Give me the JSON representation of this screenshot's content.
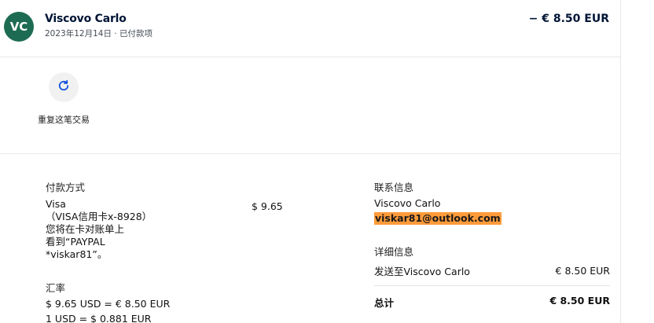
{
  "header": {
    "avatar_initials": "VC",
    "merchant_name": "Viscovo Carlo",
    "subtitle": "2023年12月14日 · 已付款项",
    "amount": "− € 8.50 EUR"
  },
  "actions": {
    "repeat_label": "重复这笔交易",
    "repeat_icon": "refresh-icon"
  },
  "funding": {
    "title": "付款方式",
    "lines": [
      "Visa",
      "（VISA信用卡x-8928）",
      "您将在卡对账单上",
      "看到“PAYPAL",
      "*viskar81”。"
    ],
    "amount": "$ 9.65"
  },
  "exchange": {
    "title": "汇率",
    "line1": "$ 9.65 USD = € 8.50 EUR",
    "line2": "1 USD = $ 0.881 EUR"
  },
  "contact": {
    "title": "联系信息",
    "name": "Viscovo Carlo",
    "email": "viskar81@outlook.com"
  },
  "details": {
    "title": "详细信息",
    "sent_label": "发送至Viscovo Carlo",
    "sent_amount": "€ 8.50 EUR",
    "total_label": "总计",
    "total_amount": "€ 8.50 EUR"
  },
  "colors": {
    "avatar_bg": "#1d6b52",
    "email_highlight": "#ff9b3a"
  }
}
